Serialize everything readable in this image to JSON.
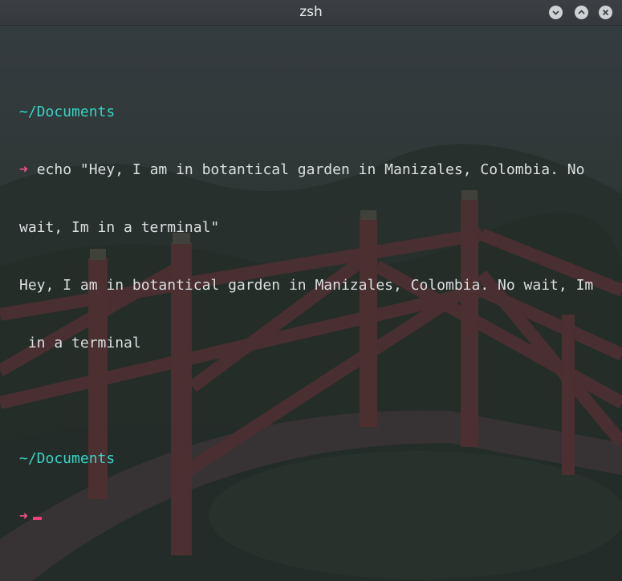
{
  "window": {
    "title": "zsh",
    "buttons": [
      {
        "name": "minimize",
        "icon": "chevron-down-icon"
      },
      {
        "name": "maximize",
        "icon": "chevron-up-icon"
      },
      {
        "name": "close",
        "icon": "close-icon"
      }
    ]
  },
  "terminal": {
    "blocks": [
      {
        "cwd": "~/Documents",
        "prompt_symbol": "➜",
        "command": "echo \"Hey, I am in botantical garden in Manizales, Colombia. No",
        "command_cont": "wait, Im in a terminal\"",
        "output_line1": "Hey, I am in botantical garden in Manizales, Colombia. No wait, Im",
        "output_line2": " in a terminal"
      },
      {
        "cwd": "~/Documents",
        "prompt_symbol": "➜",
        "command": ""
      }
    ]
  },
  "colors": {
    "cwd": "#35d5c5",
    "prompt_arrow": "#f0508a",
    "text": "#dcdfe1",
    "cursor": "#ef3f7c",
    "titlebar": "#3a3d41"
  }
}
